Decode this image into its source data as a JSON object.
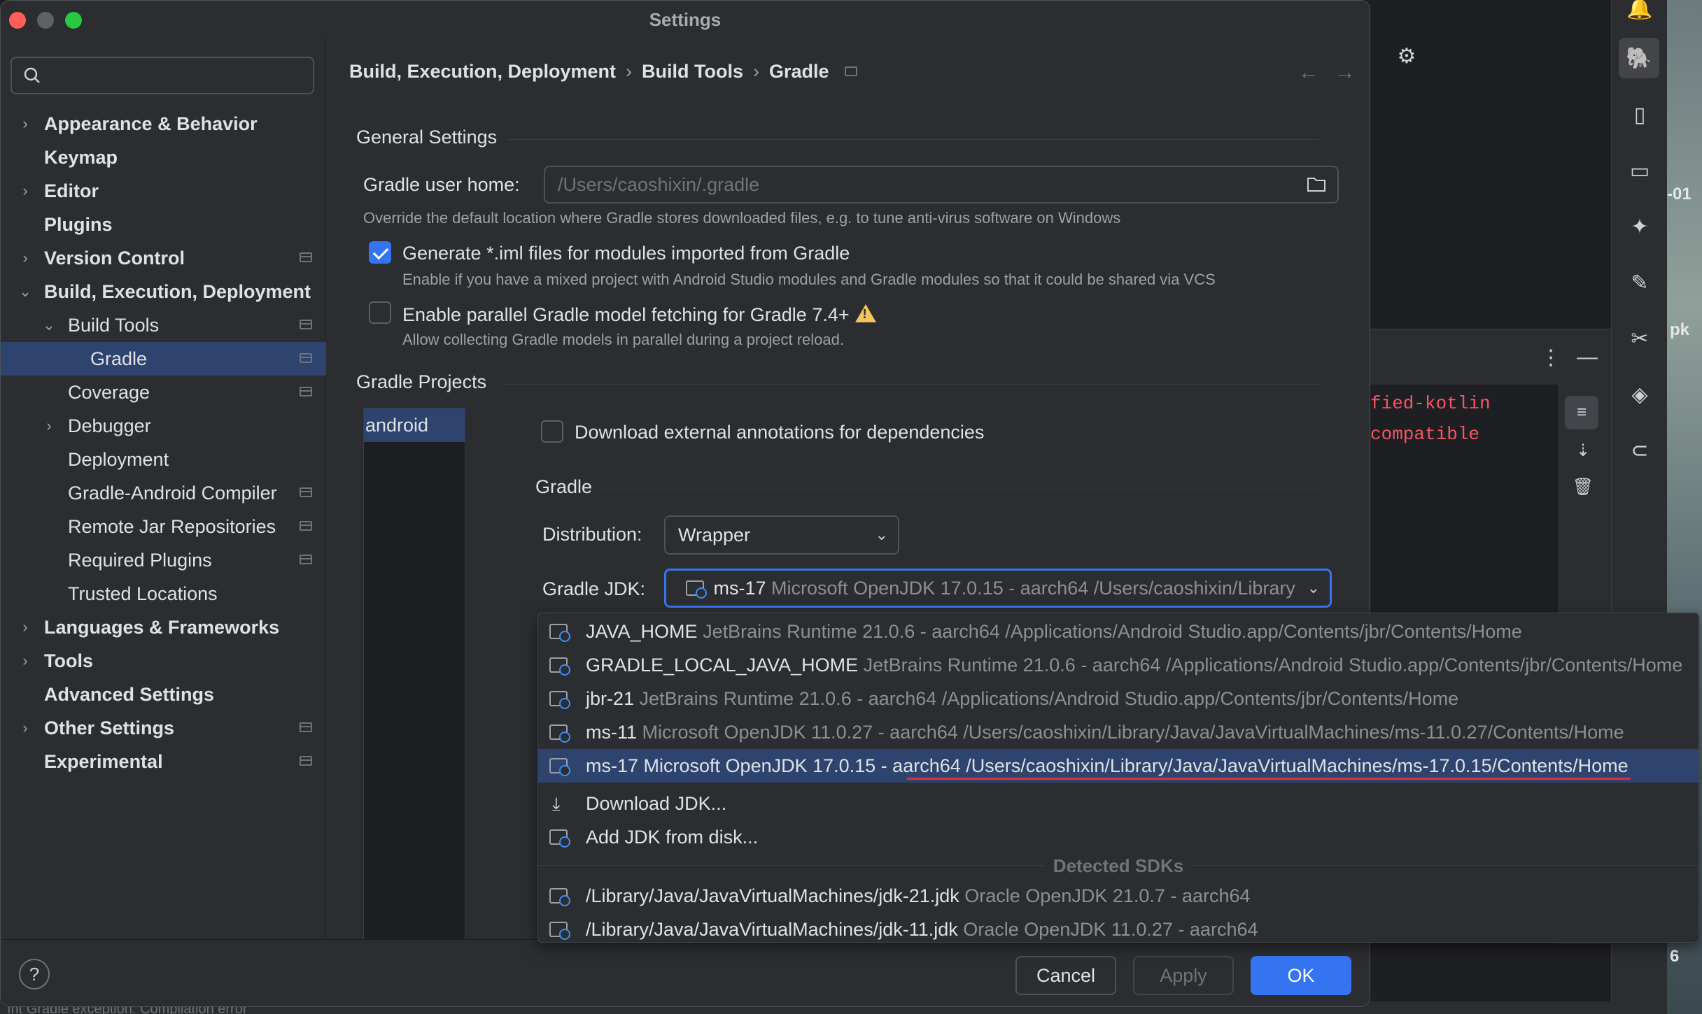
{
  "window": {
    "title": "Settings"
  },
  "search": {
    "placeholder": ""
  },
  "sidebar": {
    "items": [
      {
        "label": "Appearance & Behavior",
        "bold": true
      },
      {
        "label": "Keymap",
        "bold": true
      },
      {
        "label": "Editor",
        "bold": true
      },
      {
        "label": "Plugins",
        "bold": true
      },
      {
        "label": "Version Control",
        "bold": true
      },
      {
        "label": "Build, Execution, Deployment",
        "bold": true
      },
      {
        "label": "Build Tools",
        "bold": false
      },
      {
        "label": "Gradle",
        "bold": false
      },
      {
        "label": "Coverage",
        "bold": false
      },
      {
        "label": "Debugger",
        "bold": false
      },
      {
        "label": "Deployment",
        "bold": false
      },
      {
        "label": "Gradle-Android Compiler",
        "bold": false
      },
      {
        "label": "Remote Jar Repositories",
        "bold": false
      },
      {
        "label": "Required Plugins",
        "bold": false
      },
      {
        "label": "Trusted Locations",
        "bold": false
      },
      {
        "label": "Languages & Frameworks",
        "bold": true
      },
      {
        "label": "Tools",
        "bold": true
      },
      {
        "label": "Advanced Settings",
        "bold": true
      },
      {
        "label": "Other Settings",
        "bold": true
      },
      {
        "label": "Experimental",
        "bold": true
      }
    ]
  },
  "breadcrumb": [
    "Build, Execution, Deployment",
    "Build Tools",
    "Gradle"
  ],
  "general": {
    "title": "General Settings",
    "user_home_label": "Gradle user home:",
    "user_home_placeholder": "/Users/caoshixin/.gradle",
    "user_home_hint": "Override the default location where Gradle stores downloaded files, e.g. to tune anti-virus software on Windows",
    "iml_label": "Generate *.iml files for modules imported from Gradle",
    "iml_checked": true,
    "iml_hint": "Enable if you have a mixed project with Android Studio modules and Gradle modules so that it could be shared via VCS",
    "parallel_label": "Enable parallel Gradle model fetching for Gradle 7.4+",
    "parallel_checked": false,
    "parallel_hint": "Allow collecting Gradle models in parallel during a project reload."
  },
  "projects": {
    "title": "Gradle Projects",
    "items": [
      "android"
    ],
    "annotations_label": "Download external annotations for dependencies",
    "gradle_title": "Gradle",
    "distribution_label": "Distribution:",
    "distribution_value": "Wrapper",
    "jdk_label": "Gradle JDK:",
    "jdk_value_name": "ms-17",
    "jdk_value_detail": "Microsoft OpenJDK 17.0.15 - aarch64 /Users/caoshixin/Library"
  },
  "jdk_popup": {
    "items": [
      {
        "name": "JAVA_HOME",
        "detail": "JetBrains Runtime 21.0.6 - aarch64 /Applications/Android Studio.app/Contents/jbr/Contents/Home",
        "icon": "jdk-icon"
      },
      {
        "name": "GRADLE_LOCAL_JAVA_HOME",
        "detail": "JetBrains Runtime 21.0.6 - aarch64 /Applications/Android Studio.app/Contents/jbr/Contents/Home",
        "icon": "jdk-icon"
      },
      {
        "name": "jbr-21",
        "detail": "JetBrains Runtime 21.0.6 - aarch64 /Applications/Android Studio.app/Contents/jbr/Contents/Home",
        "icon": "jdk-icon"
      },
      {
        "name": "ms-11",
        "detail": "Microsoft OpenJDK 11.0.27 - aarch64 /Users/caoshixin/Library/Java/JavaVirtualMachines/ms-11.0.27/Contents/Home",
        "icon": "jdk-icon"
      },
      {
        "name": "ms-17",
        "detail": "Microsoft OpenJDK 17.0.15 - aarch64 /Users/caoshixin/Library/Java/JavaVirtualMachines/ms-17.0.15/Contents/Home",
        "icon": "jdk-icon",
        "selected": true
      }
    ],
    "actions": [
      {
        "label": "Download JDK...",
        "icon": "download-icon"
      },
      {
        "label": "Add JDK from disk...",
        "icon": "jdk-icon"
      }
    ],
    "detected_header": "Detected SDKs",
    "detected": [
      {
        "name": "/Library/Java/JavaVirtualMachines/jdk-21.jdk",
        "detail": "Oracle OpenJDK 21.0.7 - aarch64"
      },
      {
        "name": "/Library/Java/JavaVirtualMachines/jdk-11.jdk",
        "detail": "Oracle OpenJDK 11.0.27 - aarch64"
      }
    ]
  },
  "buttons": {
    "cancel": "Cancel",
    "apply": "Apply",
    "ok": "OK",
    "help": "?"
  },
  "background": {
    "code_lines": [
      "fied-kotlin",
      "compatible"
    ],
    "desktop_labels": [
      "-01",
      "pk",
      "6"
    ],
    "status_text": "ınt Gradle exception: Compilation error"
  },
  "colors": {
    "accent": "#3574f0",
    "selection": "#2e436e",
    "error_underline": "#e0303b",
    "warning": "#f2c55c"
  }
}
